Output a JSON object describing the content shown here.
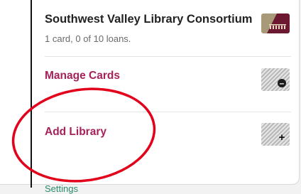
{
  "library": {
    "name": "Southwest Valley Library Consortium",
    "summary": "1 card, 0 of 10 loans.",
    "logo_colors": [
      "#a89a78",
      "#6b1830"
    ]
  },
  "actions": {
    "manage_cards_label": "Manage Cards",
    "manage_cards_icon": "minus-circle-icon",
    "add_library_label": "Add Library",
    "add_library_icon": "plus-icon"
  },
  "settings_peek": "Settings",
  "colors": {
    "accent": "#a6215a",
    "annotation": "#e3001b",
    "settings": "#2a8a6a"
  }
}
